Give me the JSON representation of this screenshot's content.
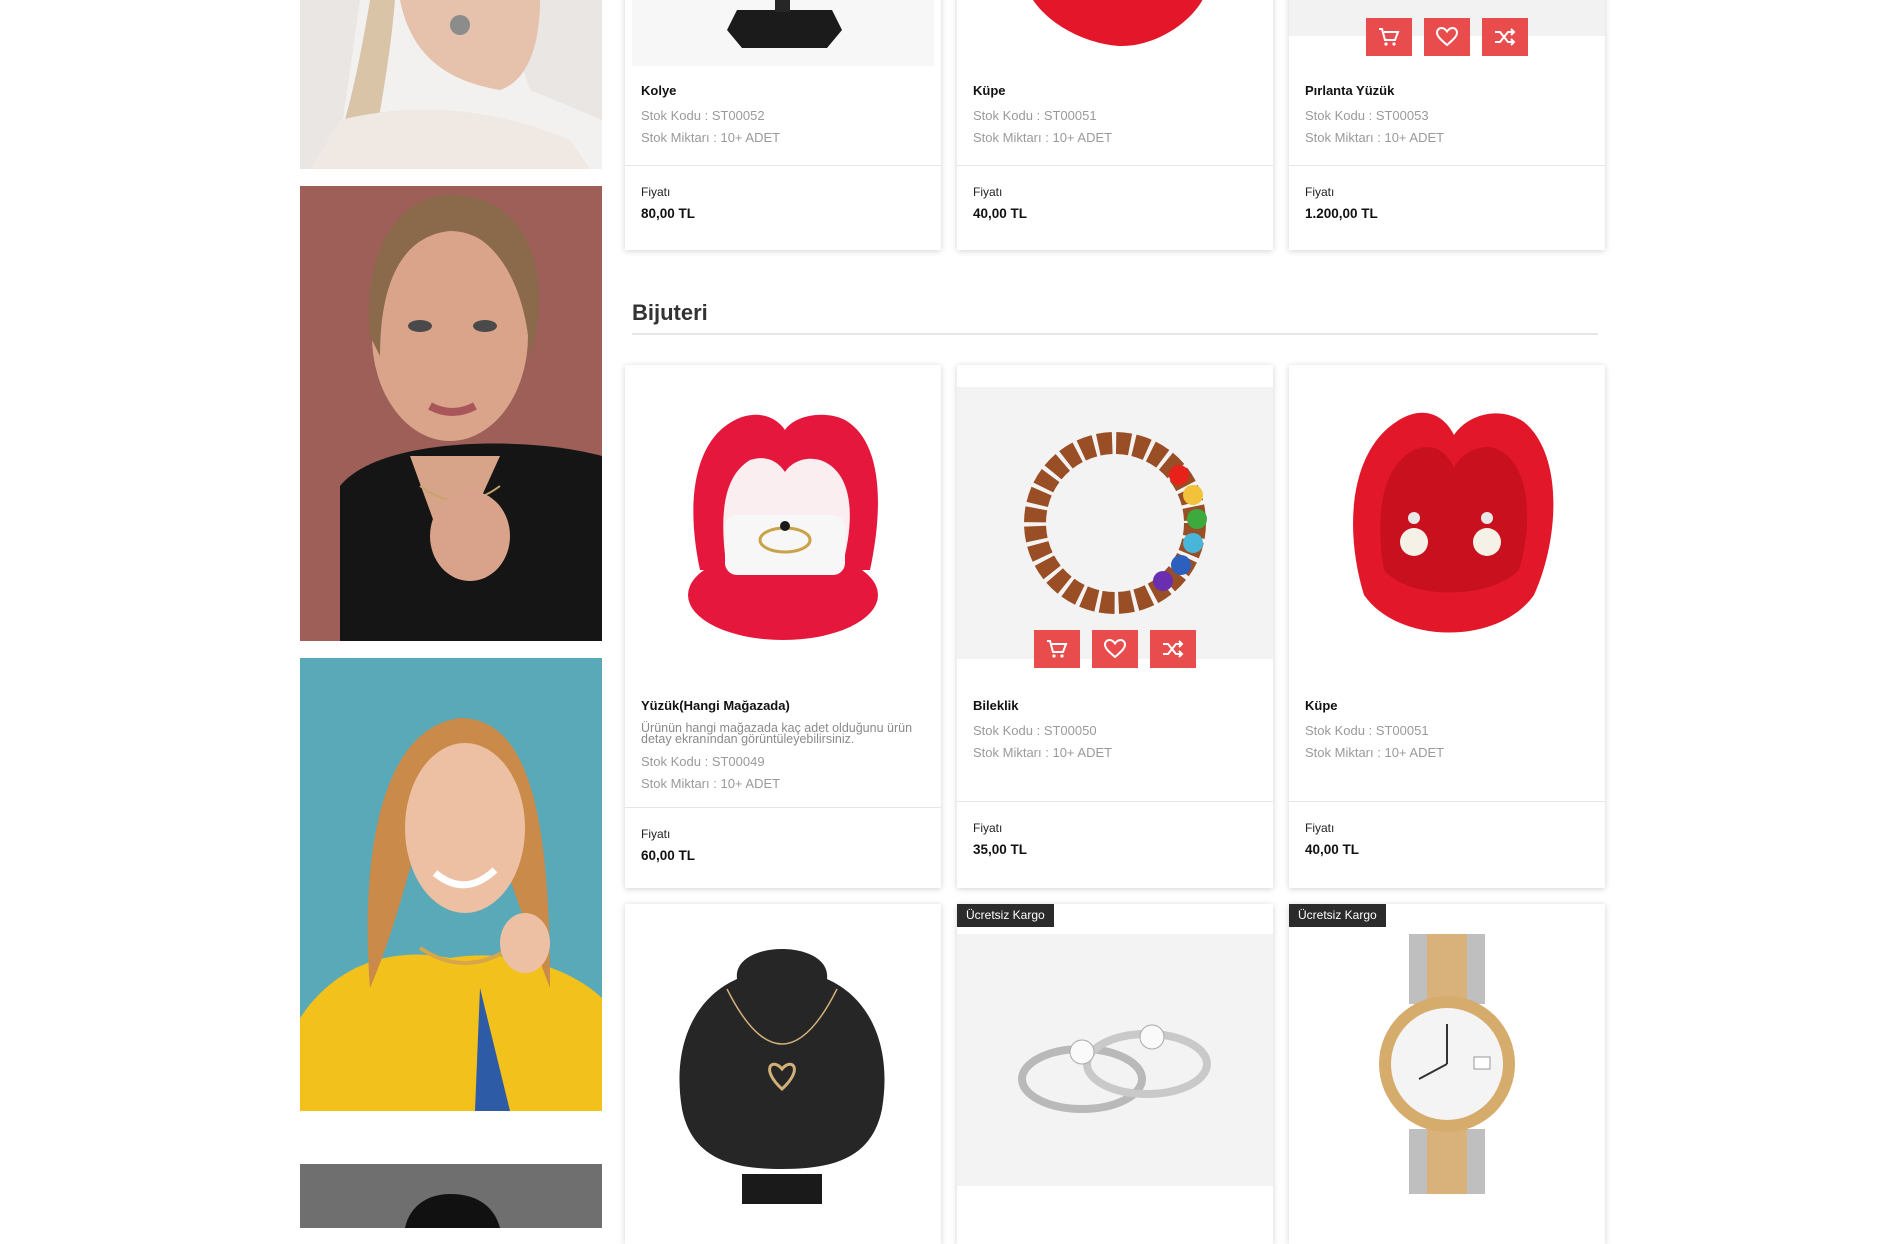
{
  "section": {
    "title": "Bijuteri"
  },
  "labels": {
    "price_label": "Fiyatı"
  },
  "top_row": [
    {
      "name": "Kolye",
      "stock_code": "Stok Kodu : ST00052",
      "stock_qty": "Stok Miktarı : 10+ ADET",
      "price": "80,00 TL"
    },
    {
      "name": "Küpe",
      "stock_code": "Stok Kodu : ST00051",
      "stock_qty": "Stok Miktarı : 10+ ADET",
      "price": "40,00 TL"
    },
    {
      "name": "Pırlanta Yüzük",
      "stock_code": "Stok Kodu : ST00053",
      "stock_qty": "Stok Miktarı : 10+ ADET",
      "price": "1.200,00 TL"
    }
  ],
  "bijuteri_row": [
    {
      "name": "Yüzük(Hangi Mağazada)",
      "description": "Ürünün hangi mağazada kaç adet olduğunu ürün detay ekranından görüntüleyebilirsiniz.",
      "stock_code": "Stok Kodu : ST00049",
      "stock_qty": "Stok Miktarı : 10+ ADET",
      "price": "60,00 TL"
    },
    {
      "name": "Bileklik",
      "stock_code": "Stok Kodu : ST00050",
      "stock_qty": "Stok Miktarı : 10+ ADET",
      "price": "35,00 TL"
    },
    {
      "name": "Küpe",
      "stock_code": "Stok Kodu : ST00051",
      "stock_qty": "Stok Miktarı : 10+ ADET",
      "price": "40,00 TL"
    }
  ],
  "bottom_row": [
    {
      "badge": ""
    },
    {
      "badge": "Ücretsiz Kargo"
    },
    {
      "badge": "Ücretsiz Kargo"
    }
  ],
  "icons": {
    "cart": "cart-icon",
    "wishlist": "heart-icon",
    "compare": "shuffle-icon"
  },
  "colors": {
    "action_button": "#e84c4c",
    "badge_bg": "#2b2b2b"
  }
}
